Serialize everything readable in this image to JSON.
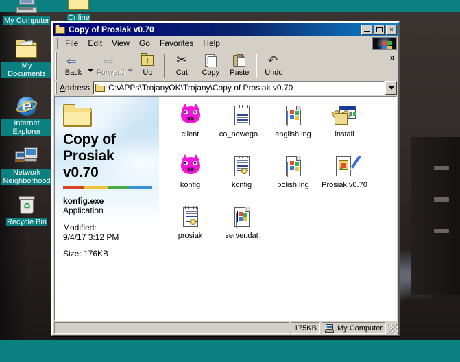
{
  "desktop": {
    "icons": [
      {
        "label": "My Computer",
        "icon": "computer-icon"
      },
      {
        "label": "My Documents",
        "icon": "documents-folder-icon"
      },
      {
        "label": "Internet Explorer",
        "icon": "internet-explorer-icon"
      },
      {
        "label": "Network Neighborhood",
        "icon": "network-icon"
      },
      {
        "label": "Recycle Bin",
        "icon": "recycle-bin-icon"
      },
      {
        "label": "Online",
        "icon": "folder-icon"
      }
    ]
  },
  "window": {
    "title": "Copy of Prosiak v0.70",
    "title_icon": "folder-icon",
    "controls": {
      "minimize": "minimize-button",
      "maximize": "maximize-button",
      "close_label": "×"
    },
    "menu": [
      {
        "label": "File",
        "accel": "F"
      },
      {
        "label": "Edit",
        "accel": "E"
      },
      {
        "label": "View",
        "accel": "V"
      },
      {
        "label": "Go",
        "accel": "G"
      },
      {
        "label": "Favorites",
        "accel": "F"
      },
      {
        "label": "Help",
        "accel": "H"
      }
    ],
    "toolbar": {
      "buttons": [
        {
          "label": "Back",
          "icon": "back-arrow-icon",
          "glyph": "⇦",
          "disabled": false,
          "dropdown": true
        },
        {
          "label": "Forward",
          "icon": "forward-arrow-icon",
          "glyph": "⇨",
          "disabled": true,
          "dropdown": true
        },
        {
          "label": "Up",
          "icon": "up-folder-icon",
          "glyph": "",
          "disabled": false,
          "dropdown": false
        },
        {
          "label": "Cut",
          "icon": "scissors-icon",
          "glyph": "✂",
          "disabled": false,
          "dropdown": false
        },
        {
          "label": "Copy",
          "icon": "copy-documents-icon",
          "glyph": "",
          "disabled": false,
          "dropdown": false
        },
        {
          "label": "Paste",
          "icon": "clipboard-icon",
          "glyph": "",
          "disabled": false,
          "dropdown": false
        },
        {
          "label": "Undo",
          "icon": "undo-arrow-icon",
          "glyph": "↶",
          "disabled": false,
          "dropdown": false
        }
      ],
      "overflow_label": "»"
    },
    "address": {
      "label": "Address",
      "value": "C:\\APPs\\TrojanyOK\\Trojany\\Copy of Prosiak v0.70",
      "icon": "folder-icon"
    },
    "info_pane": {
      "folder_icon": "folder-icon",
      "title": "Copy of Prosiak v0.70",
      "selected_file": "konfig.exe",
      "file_type": "Application",
      "modified_label": "Modified:",
      "modified_value": "9/4/17 3:12 PM",
      "size_line": "Size: 176KB"
    },
    "files": [
      {
        "name": "client",
        "icon": "pig-icon"
      },
      {
        "name": "co_nowego...",
        "icon": "text-document-icon"
      },
      {
        "name": "english.lng",
        "icon": "language-flag-icon"
      },
      {
        "name": "install",
        "icon": "setup-box-icon"
      },
      {
        "name": "konfig",
        "icon": "pig-icon"
      },
      {
        "name": "konfig",
        "icon": "config-document-icon"
      },
      {
        "name": "polish.lng",
        "icon": "language-flag-icon"
      },
      {
        "name": "Prosiak v0.70",
        "icon": "pen-document-icon"
      },
      {
        "name": "prosiak",
        "icon": "config-document-icon"
      },
      {
        "name": "server.dat",
        "icon": "language-flag-icon"
      }
    ],
    "statusbar": {
      "main": "",
      "size": "175KB",
      "zone": "My Computer",
      "zone_icon": "computer-icon"
    }
  },
  "colors": {
    "desktop_teal": "#0a8080",
    "titlebar_blue": "#0a246a",
    "face": "#d4d0c8",
    "pig_magenta": "#f018d8"
  }
}
